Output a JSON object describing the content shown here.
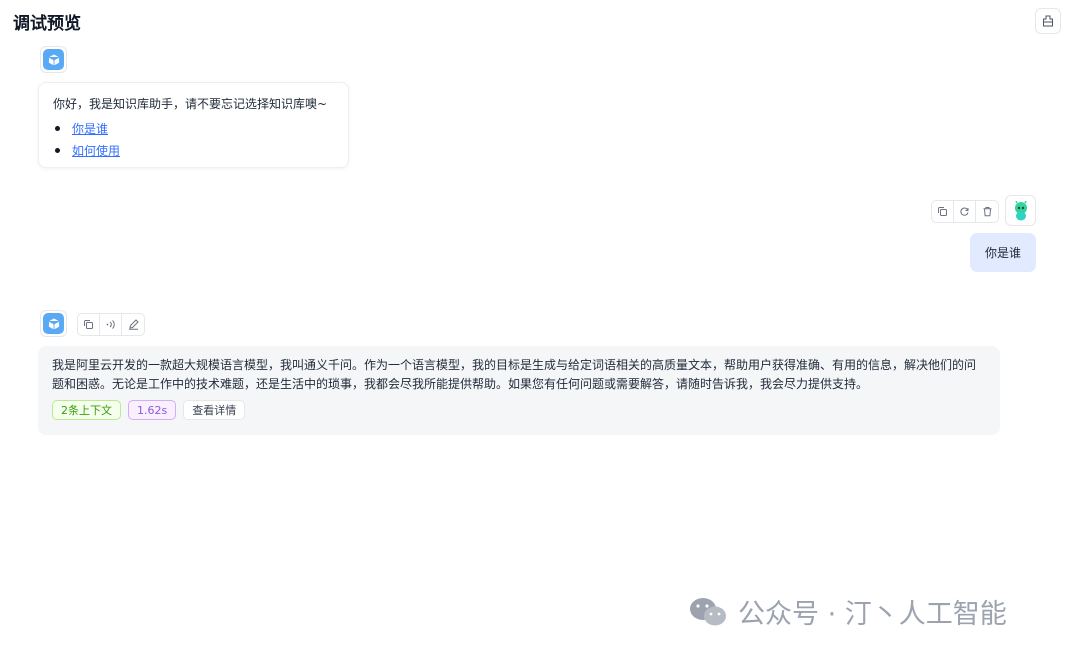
{
  "header": {
    "title": "调试预览"
  },
  "welcome": {
    "text": "你好，我是知识库助手，请不要忘记选择知识库噢~",
    "questions": [
      "你是谁",
      "如何使用"
    ]
  },
  "user_message": {
    "text": "你是谁"
  },
  "answer": {
    "text": "我是阿里云开发的一款超大规模语言模型，我叫通义千问。作为一个语言模型，我的目标是生成与给定词语相关的高质量文本，帮助用户获得准确、有用的信息，解决他们的问题和困惑。无论是工作中的技术难题，还是生活中的琐事，我都会尽我所能提供帮助。如果您有任何问题或需要解答，请随时告诉我，我会尽力提供支持。",
    "context_tag": "2条上下文",
    "time_tag": "1.62s",
    "detail_button": "查看详情"
  },
  "watermark": {
    "text": "公众号 · 汀丶人工智能"
  },
  "icons": {
    "top_button": "clear-icon",
    "bot_avatar": "cube-icon",
    "user_avatar": "user-avatar-icon",
    "user_tools": [
      "copy-icon",
      "retry-icon",
      "delete-icon"
    ],
    "bot_tools": [
      "copy-icon",
      "speaker-icon",
      "edit-icon"
    ]
  },
  "colors": {
    "accent": "#3370ff",
    "bubble": "#e1eaff",
    "avatar": "#5aa9f5"
  }
}
